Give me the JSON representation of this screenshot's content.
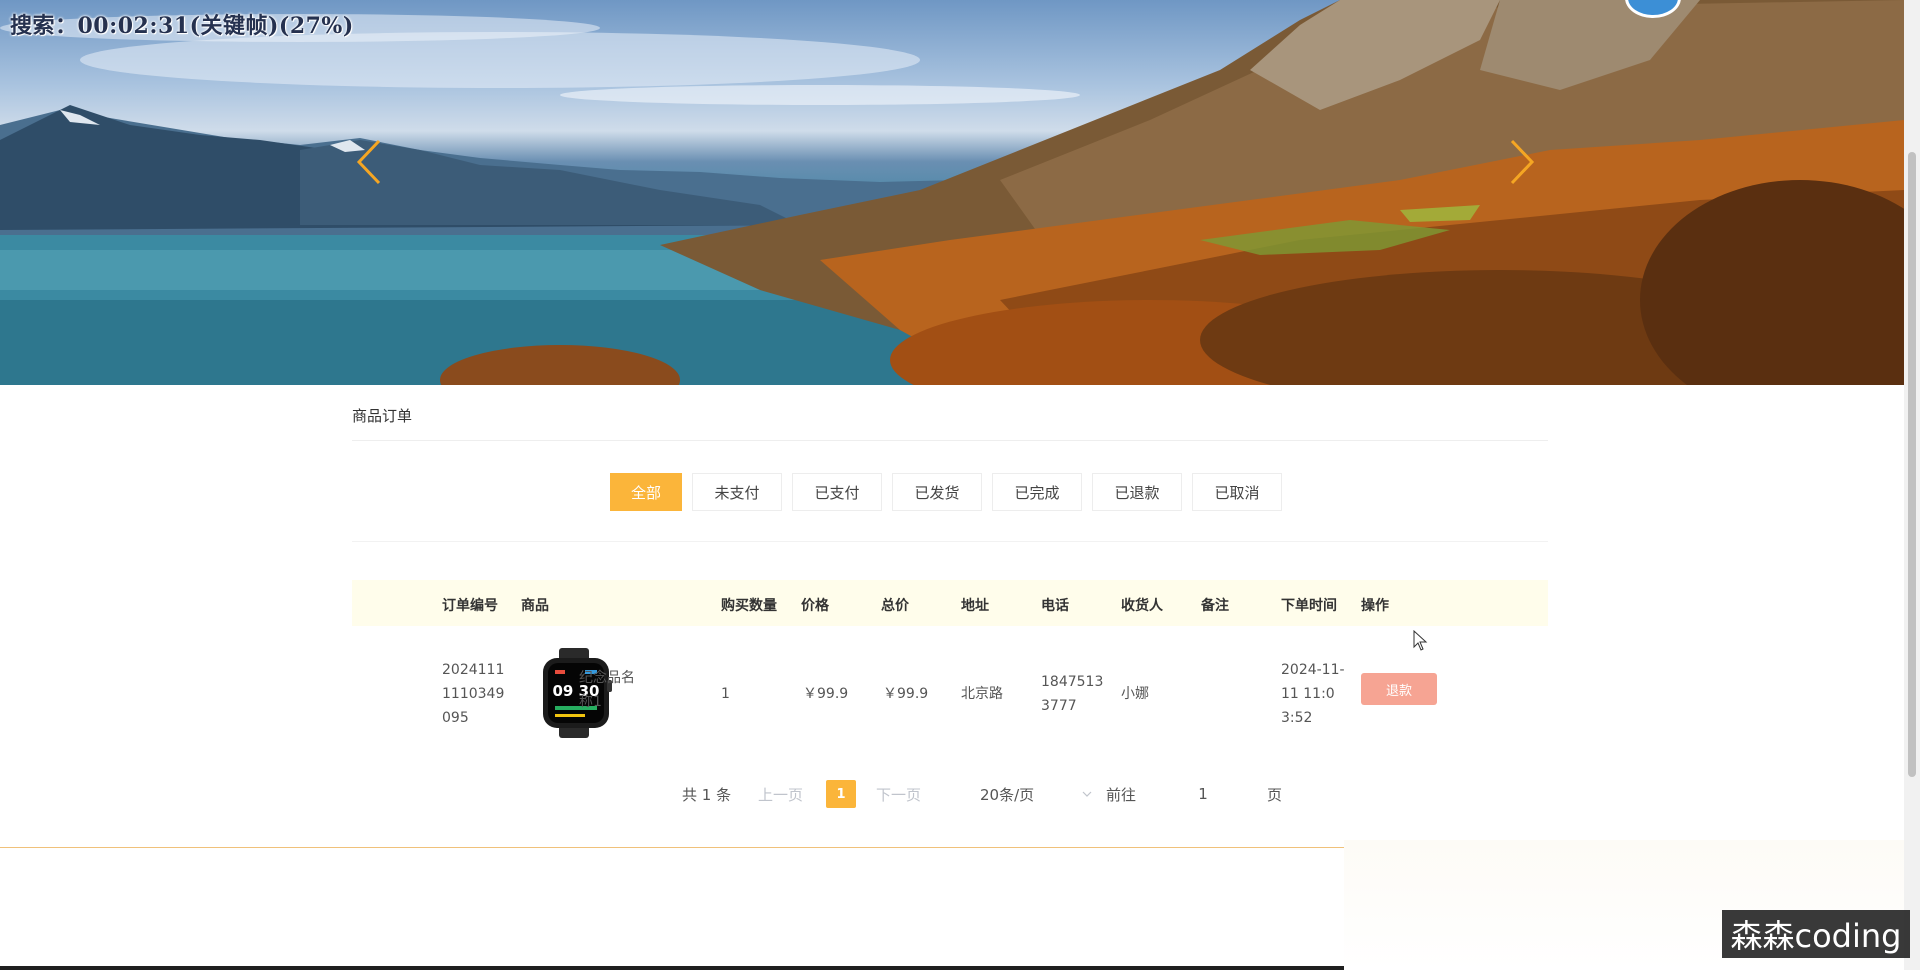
{
  "overlay": {
    "text": "搜索：00:02:31(关键帧)(27%)"
  },
  "banner": {
    "prev_arrow_icon": "chevron-left-icon",
    "next_arrow_icon": "chevron-right-icon",
    "arrow_color": "#f5a623"
  },
  "section": {
    "title": "商品订单"
  },
  "tabs": [
    {
      "label": "全部",
      "active": true
    },
    {
      "label": "未支付"
    },
    {
      "label": "已支付"
    },
    {
      "label": "已发货"
    },
    {
      "label": "已完成"
    },
    {
      "label": "已退款"
    },
    {
      "label": "已取消"
    }
  ],
  "table": {
    "headers": [
      "订单编号",
      "商品",
      "购买数量",
      "价格",
      "总价",
      "地址",
      "电话",
      "收货人",
      "备注",
      "下单时间",
      "操作"
    ],
    "rows": [
      {
        "order_no_lines": [
          "2024111",
          "1110349",
          "095"
        ],
        "product_name_lines": [
          "纪念品名",
          "称1"
        ],
        "quantity": "1",
        "price": "￥99.9",
        "total": "￥99.9",
        "address": "北京路",
        "phone_lines": [
          "1847513",
          "3777"
        ],
        "receiver": "小娜",
        "remark": "",
        "time_lines": [
          "2024-11-",
          "11 11:0",
          "3:52"
        ],
        "action": "退款"
      }
    ]
  },
  "pagination": {
    "total": "共 1 条",
    "prev": "上一页",
    "current_page": "1",
    "next": "下一页",
    "page_size": "20条/页",
    "goto_label": "前往",
    "goto_value": "1",
    "page_suffix": "页"
  },
  "watermark": {
    "text": "森森coding"
  },
  "colors": {
    "accent": "#fbb53a",
    "refund": "#f6a493",
    "table_header_bg": "#fffdeb"
  }
}
